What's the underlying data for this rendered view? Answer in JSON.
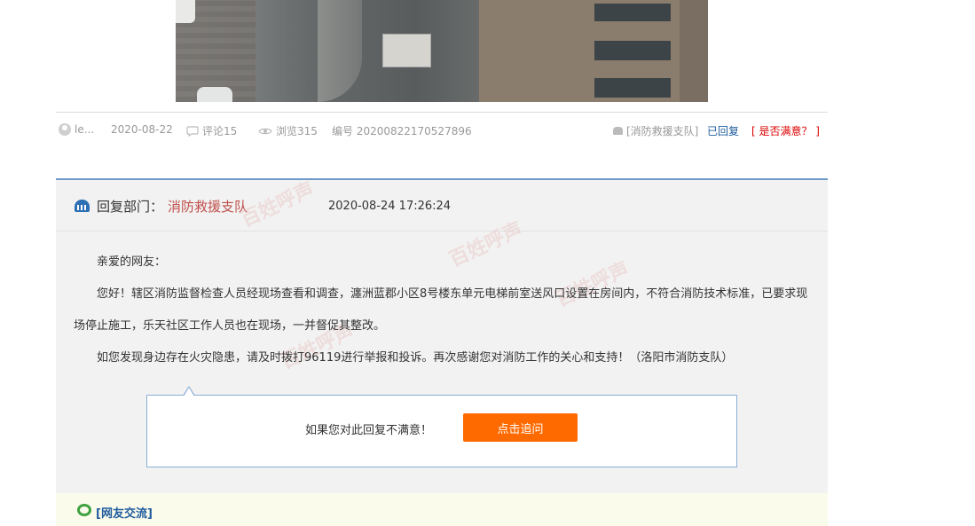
{
  "meta": {
    "author": "le...",
    "date": "2020-08-22",
    "comments": "评论15",
    "views": "浏览315",
    "serial": "编号 20200822170527896",
    "department_tag": "[消防救援支队]",
    "replied": "已回复",
    "satisfied_link": "[ 是否满意？ ]"
  },
  "reply": {
    "dept_label": "回复部门：",
    "dept_name": "消防救援支队",
    "time": "2020-08-24 17:26:24",
    "greeting": "亲爱的网友：",
    "paragraph1": "您好！辖区消防监督检查人员经现场查看和调查，瀍洲蓝郡小区8号楼东单元电梯前室送风口设置在房间内，不符合消防技术标准，已要求现场停止施工，乐天社区工作人员也在现场，一并督促其整改。",
    "paragraph2": "如您发现身边存在火灾隐患，请及时拨打96119进行举报和投诉。再次感谢您对消防工作的关心和支持！（洛阳市消防支队）"
  },
  "followup": {
    "text": "如果您对此回复不满意！",
    "button": "点击追问"
  },
  "forum": {
    "label": "[网友交流]"
  },
  "colors": {
    "accent_blue": "#6e9acb",
    "dept_red": "#c0504d",
    "button_orange": "#ff6a00",
    "link_blue": "#1f5c9e"
  }
}
